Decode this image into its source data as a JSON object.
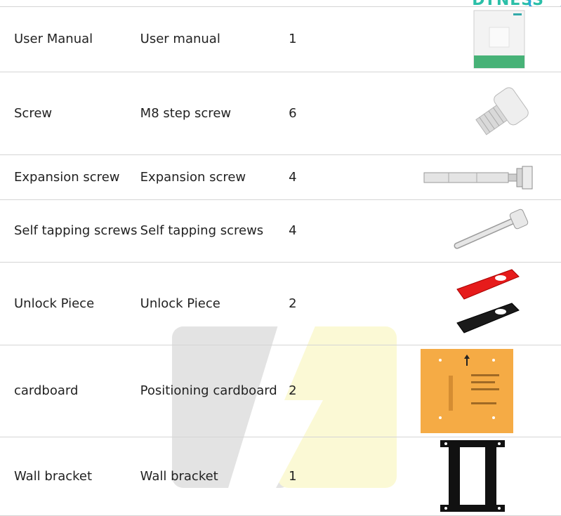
{
  "brand": {
    "logo_text": "DYNESS"
  },
  "rows": [
    {
      "name": "User Manual",
      "description": "User manual",
      "qty": "1",
      "image_icon": "user-manual-booklet-icon"
    },
    {
      "name": "Screw",
      "description": "M8 step screw",
      "qty": "6",
      "image_icon": "step-screw-icon"
    },
    {
      "name": "Expansion screw",
      "description": "Expansion screw",
      "qty": "4",
      "image_icon": "expansion-screw-icon"
    },
    {
      "name": "Self tapping screws",
      "description": "Self tapping screws",
      "qty": "4",
      "image_icon": "self-tapping-screw-icon"
    },
    {
      "name": "Unlock Piece",
      "description": "Unlock Piece",
      "qty": "2",
      "image_icon": "unlock-piece-icon"
    },
    {
      "name": "cardboard",
      "description": "Positioning cardboard",
      "qty": "2",
      "image_icon": "positioning-cardboard-icon"
    },
    {
      "name": "Wall bracket",
      "description": "Wall bracket",
      "qty": "1",
      "image_icon": "wall-bracket-icon"
    }
  ]
}
